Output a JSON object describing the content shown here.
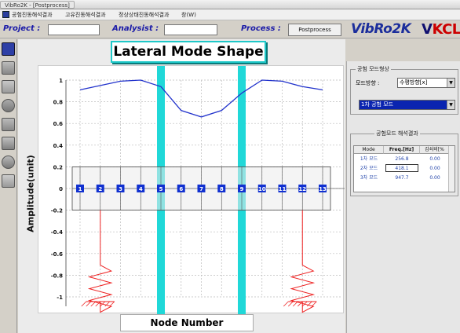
{
  "titlebar": {
    "tab": "VibRo2K - [Postprocess]"
  },
  "menu": {
    "items": [
      "공험진동해석결과",
      "고유진동해석결과",
      "정상상태진동해석결과",
      "창(W)"
    ]
  },
  "fields": {
    "project_label": "Project :",
    "project_value": "",
    "analysist_label": "Analysist :",
    "analysist_value": "",
    "process_label": "Process :",
    "process_button": "Postprocess"
  },
  "logos": {
    "vibro": "VibRo2K",
    "vkcl_v": "V",
    "vkcl_k": "K",
    "vkcl_cl": "CL"
  },
  "toolbar": {
    "icons": [
      "model-icon",
      "shaft-icon",
      "bearing-icon",
      "disk-icon",
      "rotor-icon",
      "seal-icon",
      "coupling-icon",
      "print-icon"
    ]
  },
  "plot": {
    "title": "Lateral Mode Shape",
    "xlabel": "Node Number",
    "ylabel": "Amplitude(unit)"
  },
  "chart_data": {
    "type": "line",
    "title": "Lateral Mode Shape",
    "xlabel": "Node Number",
    "ylabel": "Amplitude(unit)",
    "ylim": [
      -1,
      1
    ],
    "yticks": [
      "1",
      "0.8",
      "0.6",
      "0.4",
      "0.2",
      "0",
      "-0.2",
      "-0.4",
      "-0.6",
      "-0.8",
      "-1"
    ],
    "nodes": [
      "1",
      "2",
      "3",
      "4",
      "5",
      "6",
      "7",
      "8",
      "9",
      "10",
      "11",
      "12",
      "13"
    ],
    "series": [
      {
        "values": [
          0.91,
          0.95,
          0.99,
          1.0,
          0.94,
          0.72,
          0.66,
          0.72,
          0.88,
          1.0,
          0.99,
          0.94,
          0.91
        ]
      }
    ],
    "bearings_at_nodes": [
      "5",
      "9"
    ],
    "springs_at_nodes": [
      "2",
      "12"
    ],
    "grid": true,
    "colors": {
      "line": "#2233cc",
      "bearing": "#20d8d8",
      "spring": "#ee2222",
      "node": "#1030d0"
    }
  },
  "right_panel": {
    "mode_shape_title": "공험 모드형상",
    "mode_dir_label": "모드방향 :",
    "mode_dir_value": "수평방향[x]",
    "mode_select_value": "1차 공험 모드",
    "results_title": "공험모드 해석결과",
    "table": {
      "headers": [
        "Mode",
        "Freq.[Hz]",
        "감쇠비[%"
      ],
      "rows": [
        [
          "1차 모드",
          "256.8",
          "0.00"
        ],
        [
          "2차 모드",
          "418.1",
          "0.00"
        ],
        [
          "3차 모드",
          "947.7",
          "0.00"
        ]
      ]
    }
  }
}
